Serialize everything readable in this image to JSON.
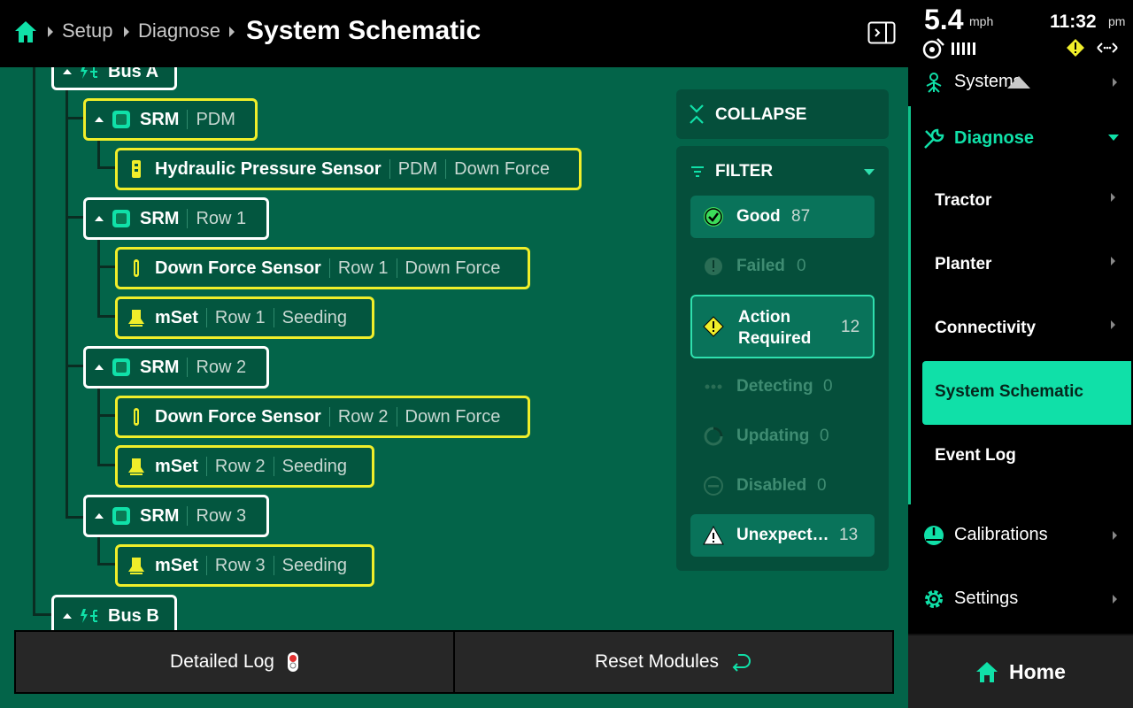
{
  "header": {
    "breadcrumb": [
      "Setup",
      "Diagnose"
    ],
    "title": "System Schematic"
  },
  "status": {
    "speed": "5.4",
    "speed_unit": "mph",
    "time": "11:32",
    "ampm": "pm"
  },
  "tree": {
    "bus_a": "Bus A",
    "bus_b": "Bus B",
    "nodes": [
      {
        "name": "SRM",
        "meta": [
          "PDM"
        ]
      },
      {
        "name": "Hydraulic Pressure Sensor",
        "meta": [
          "PDM",
          "Down Force"
        ]
      },
      {
        "name": "SRM",
        "meta": [
          "Row 1"
        ]
      },
      {
        "name": "Down Force Sensor",
        "meta": [
          "Row 1",
          "Down Force"
        ]
      },
      {
        "name": "mSet",
        "meta": [
          "Row 1",
          "Seeding"
        ]
      },
      {
        "name": "SRM",
        "meta": [
          "Row 2"
        ]
      },
      {
        "name": "Down Force Sensor",
        "meta": [
          "Row 2",
          "Down Force"
        ]
      },
      {
        "name": "mSet",
        "meta": [
          "Row 2",
          "Seeding"
        ]
      },
      {
        "name": "SRM",
        "meta": [
          "Row 3"
        ]
      },
      {
        "name": "mSet",
        "meta": [
          "Row 3",
          "Seeding"
        ]
      }
    ]
  },
  "panel": {
    "collapse": "COLLAPSE",
    "filter": "FILTER",
    "items": [
      {
        "label": "Good",
        "count": "87"
      },
      {
        "label": "Failed",
        "count": "0"
      },
      {
        "label": "Action Required",
        "count": "12"
      },
      {
        "label": "Detecting",
        "count": "0"
      },
      {
        "label": "Updating",
        "count": "0"
      },
      {
        "label": "Disabled",
        "count": "0"
      },
      {
        "label": "Unexpect…",
        "count": "13"
      }
    ]
  },
  "actions": {
    "detailed_log": "Detailed Log",
    "reset_modules": "Reset Modules"
  },
  "sidebar": {
    "systems": "Systems",
    "diagnose": "Diagnose",
    "sub": [
      "Tractor",
      "Planter",
      "Connectivity",
      "System Schematic",
      "Event Log"
    ],
    "calibrations": "Calibrations",
    "settings": "Settings",
    "home": "Home"
  },
  "colors": {
    "accent": "#10e0a8",
    "background": "#036449",
    "node_warning_border": "#f0ee2a",
    "node_ok_border": "#ffffff"
  }
}
